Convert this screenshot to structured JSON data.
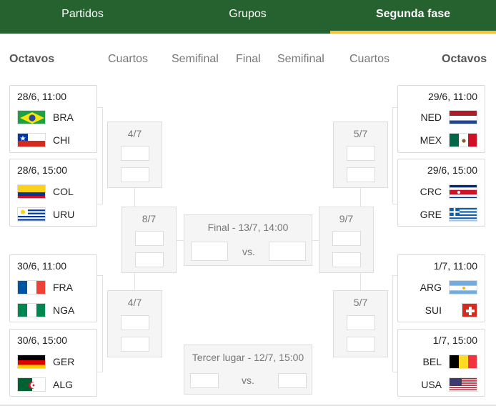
{
  "tabs": [
    {
      "label": "Partidos",
      "active": false
    },
    {
      "label": "Grupos",
      "active": false
    },
    {
      "label": "Segunda fase",
      "active": true
    }
  ],
  "columns": {
    "left_octavos": "Octavos",
    "left_cuartos": "Cuartos",
    "left_semifinal": "Semifinal",
    "final": "Final",
    "right_semifinal": "Semifinal",
    "right_cuartos": "Cuartos",
    "right_octavos": "Octavos"
  },
  "octavos_left": [
    {
      "date": "28/6, 11:00",
      "team1": {
        "code": "BRA",
        "flag": "brazil-flag-icon"
      },
      "team2": {
        "code": "CHI",
        "flag": "chile-flag-icon"
      }
    },
    {
      "date": "28/6, 15:00",
      "team1": {
        "code": "COL",
        "flag": "colombia-flag-icon"
      },
      "team2": {
        "code": "URU",
        "flag": "uruguay-flag-icon"
      }
    },
    {
      "date": "30/6, 11:00",
      "team1": {
        "code": "FRA",
        "flag": "france-flag-icon"
      },
      "team2": {
        "code": "NGA",
        "flag": "nigeria-flag-icon"
      }
    },
    {
      "date": "30/6, 15:00",
      "team1": {
        "code": "GER",
        "flag": "germany-flag-icon"
      },
      "team2": {
        "code": "ALG",
        "flag": "algeria-flag-icon"
      }
    }
  ],
  "octavos_right": [
    {
      "date": "29/6, 11:00",
      "team1": {
        "code": "NED",
        "flag": "netherlands-flag-icon"
      },
      "team2": {
        "code": "MEX",
        "flag": "mexico-flag-icon"
      }
    },
    {
      "date": "29/6, 15:00",
      "team1": {
        "code": "CRC",
        "flag": "costa-rica-flag-icon"
      },
      "team2": {
        "code": "GRE",
        "flag": "greece-flag-icon"
      }
    },
    {
      "date": "1/7, 11:00",
      "team1": {
        "code": "ARG",
        "flag": "argentina-flag-icon"
      },
      "team2": {
        "code": "SUI",
        "flag": "switzerland-flag-icon"
      }
    },
    {
      "date": "1/7, 15:00",
      "team1": {
        "code": "BEL",
        "flag": "belgium-flag-icon"
      },
      "team2": {
        "code": "USA",
        "flag": "usa-flag-icon"
      }
    }
  ],
  "cuartos_left": [
    "4/7",
    "4/7"
  ],
  "cuartos_right": [
    "5/7",
    "5/7"
  ],
  "semifinal_left": "8/7",
  "semifinal_right": "9/7",
  "final": {
    "label": "Final - 13/7, 14:00",
    "vs": "vs."
  },
  "third_place": {
    "label": "Tercer lugar - 12/7, 15:00",
    "vs": "vs."
  },
  "colors": {
    "header_bg": "#25622f",
    "active_underline": "#f3c33e",
    "grey_box": "#f5f5f5",
    "border": "#d9d9d9"
  }
}
